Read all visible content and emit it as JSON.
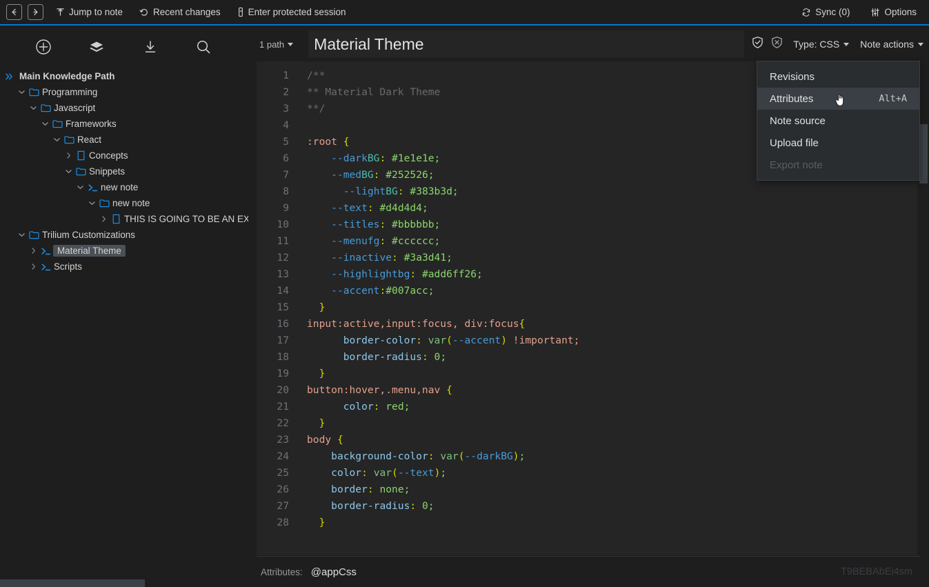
{
  "toolbar": {
    "back_icon": "arrow-left-icon",
    "forward_icon": "arrow-right-icon",
    "jump_to_note": "Jump to note",
    "jump_icon": "map-pin-icon",
    "recent_changes": "Recent changes",
    "recent_icon": "history-icon",
    "protected_session": "Enter protected session",
    "protected_icon": "key-icon",
    "sync": "Sync (0)",
    "sync_icon": "refresh-icon",
    "options": "Options",
    "options_icon": "sliders-icon",
    "accent_color": "#007acc"
  },
  "sidebar": {
    "tools": [
      {
        "name": "new-note-icon",
        "label": "plus-circle-icon"
      },
      {
        "name": "note-map-icon",
        "label": "layers-icon"
      },
      {
        "name": "collapse-tree-icon",
        "label": "download-icon"
      },
      {
        "name": "search-icon",
        "label": "search-icon"
      }
    ],
    "tree": [
      {
        "label": "Main Knowledge Path",
        "depth": 0,
        "twisty": "root",
        "icon": "root-chevrons-icon",
        "selected": false
      },
      {
        "label": "Programming",
        "depth": 1,
        "twisty": "down",
        "icon": "folder-icon",
        "selected": false
      },
      {
        "label": "Javascript",
        "depth": 2,
        "twisty": "down",
        "icon": "folder-icon",
        "selected": false
      },
      {
        "label": "Frameworks",
        "depth": 3,
        "twisty": "down",
        "icon": "folder-icon",
        "selected": false
      },
      {
        "label": "React",
        "depth": 4,
        "twisty": "down",
        "icon": "folder-icon",
        "selected": false
      },
      {
        "label": "Concepts",
        "depth": 5,
        "twisty": "right",
        "icon": "note-icon",
        "selected": false
      },
      {
        "label": "Snippets",
        "depth": 5,
        "twisty": "down",
        "icon": "folder-icon",
        "selected": false
      },
      {
        "label": "new note",
        "depth": 6,
        "twisty": "down",
        "icon": "code-icon",
        "selected": false
      },
      {
        "label": "new note",
        "depth": 7,
        "twisty": "down",
        "icon": "folder-icon",
        "selected": false
      },
      {
        "label": "THIS IS GOING TO BE AN EXT",
        "depth": 8,
        "twisty": "right",
        "icon": "note-icon",
        "selected": false
      },
      {
        "label": "Trilium Customizations",
        "depth": 1,
        "twisty": "down",
        "icon": "folder-icon",
        "selected": false
      },
      {
        "label": "Material Theme",
        "depth": 2,
        "twisty": "right",
        "icon": "code-icon",
        "selected": true
      },
      {
        "label": "Scripts",
        "depth": 2,
        "twisty": "right",
        "icon": "code-icon",
        "selected": false
      }
    ]
  },
  "note": {
    "path_label": "1 path",
    "title": "Material Theme",
    "protect_on_icon": "shield-check-icon",
    "protect_off_icon": "shield-x-icon",
    "type_label": "Type: CSS",
    "actions_label": "Note actions"
  },
  "menu": {
    "items": [
      {
        "label": "Revisions",
        "shortcut": "",
        "active": false,
        "disabled": false
      },
      {
        "label": "Attributes",
        "shortcut": "Alt+A",
        "active": true,
        "disabled": false
      },
      {
        "label": "Note source",
        "shortcut": "",
        "active": false,
        "disabled": false
      },
      {
        "label": "Upload file",
        "shortcut": "",
        "active": false,
        "disabled": false
      },
      {
        "label": "Export note",
        "shortcut": "",
        "active": false,
        "disabled": true
      }
    ]
  },
  "editor": {
    "language": "css",
    "lines": [
      {
        "n": 1,
        "tokens": [
          {
            "t": "/**",
            "c": "c-com"
          }
        ]
      },
      {
        "n": 2,
        "tokens": [
          {
            "t": "** Material Dark Theme",
            "c": "c-com"
          }
        ]
      },
      {
        "n": 3,
        "tokens": [
          {
            "t": "**/",
            "c": "c-com"
          }
        ]
      },
      {
        "n": 4,
        "tokens": []
      },
      {
        "n": 5,
        "tokens": [
          {
            "t": ":root",
            "c": "c-sel"
          },
          {
            "t": " ",
            "c": ""
          },
          {
            "t": "{",
            "c": "c-brace"
          }
        ]
      },
      {
        "n": 6,
        "tokens": [
          {
            "t": "    ",
            "c": ""
          },
          {
            "t": "--dark",
            "c": "c-var"
          },
          {
            "t": "BG",
            "c": "c-varg"
          },
          {
            "t": ":",
            "c": "c-colon"
          },
          {
            "t": " ",
            "c": ""
          },
          {
            "t": "#1e1e1e;",
            "c": "c-val"
          }
        ]
      },
      {
        "n": 7,
        "tokens": [
          {
            "t": "    ",
            "c": ""
          },
          {
            "t": "--med",
            "c": "c-var"
          },
          {
            "t": "BG",
            "c": "c-varg"
          },
          {
            "t": ":",
            "c": "c-colon"
          },
          {
            "t": " ",
            "c": ""
          },
          {
            "t": "#252526;",
            "c": "c-val"
          }
        ]
      },
      {
        "n": 8,
        "tokens": [
          {
            "t": "      ",
            "c": ""
          },
          {
            "t": "--light",
            "c": "c-var"
          },
          {
            "t": "BG",
            "c": "c-varg"
          },
          {
            "t": ":",
            "c": "c-colon"
          },
          {
            "t": " ",
            "c": ""
          },
          {
            "t": "#383b3d;",
            "c": "c-val"
          }
        ]
      },
      {
        "n": 9,
        "tokens": [
          {
            "t": "    ",
            "c": ""
          },
          {
            "t": "--text",
            "c": "c-var"
          },
          {
            "t": ":",
            "c": "c-colon"
          },
          {
            "t": " ",
            "c": ""
          },
          {
            "t": "#d4d4d4;",
            "c": "c-val"
          }
        ]
      },
      {
        "n": 10,
        "tokens": [
          {
            "t": "    ",
            "c": ""
          },
          {
            "t": "--titles",
            "c": "c-var"
          },
          {
            "t": ":",
            "c": "c-colon"
          },
          {
            "t": " ",
            "c": ""
          },
          {
            "t": "#bbbbbb;",
            "c": "c-val"
          }
        ]
      },
      {
        "n": 11,
        "tokens": [
          {
            "t": "    ",
            "c": ""
          },
          {
            "t": "--menufg",
            "c": "c-var"
          },
          {
            "t": ":",
            "c": "c-colon"
          },
          {
            "t": " ",
            "c": ""
          },
          {
            "t": "#cccccc;",
            "c": "c-val"
          }
        ]
      },
      {
        "n": 12,
        "tokens": [
          {
            "t": "    ",
            "c": ""
          },
          {
            "t": "--inactive",
            "c": "c-var"
          },
          {
            "t": ":",
            "c": "c-colon"
          },
          {
            "t": " ",
            "c": ""
          },
          {
            "t": "#3a3d41;",
            "c": "c-val"
          }
        ]
      },
      {
        "n": 13,
        "tokens": [
          {
            "t": "    ",
            "c": ""
          },
          {
            "t": "--highlightbg",
            "c": "c-var"
          },
          {
            "t": ":",
            "c": "c-colon"
          },
          {
            "t": " ",
            "c": ""
          },
          {
            "t": "#add6ff26;",
            "c": "c-val"
          }
        ]
      },
      {
        "n": 14,
        "tokens": [
          {
            "t": "    ",
            "c": ""
          },
          {
            "t": "--accent",
            "c": "c-var"
          },
          {
            "t": ":",
            "c": "c-colon"
          },
          {
            "t": "#007acc;",
            "c": "c-val"
          }
        ]
      },
      {
        "n": 15,
        "tokens": [
          {
            "t": "  ",
            "c": ""
          },
          {
            "t": "}",
            "c": "c-brace"
          }
        ]
      },
      {
        "n": 16,
        "tokens": [
          {
            "t": "input:active,input:focus, div:focus",
            "c": "c-sel"
          },
          {
            "t": "{",
            "c": "c-brace"
          }
        ]
      },
      {
        "n": 17,
        "tokens": [
          {
            "t": "      ",
            "c": ""
          },
          {
            "t": "border-color",
            "c": "c-prop"
          },
          {
            "t": ":",
            "c": "c-colon"
          },
          {
            "t": " ",
            "c": ""
          },
          {
            "t": "var",
            "c": "c-fn"
          },
          {
            "t": "(",
            "c": "c-paren"
          },
          {
            "t": "--accent",
            "c": "c-var"
          },
          {
            "t": ")",
            "c": "c-paren"
          },
          {
            "t": " ",
            "c": ""
          },
          {
            "t": "!important;",
            "c": "c-imp"
          }
        ]
      },
      {
        "n": 18,
        "tokens": [
          {
            "t": "      ",
            "c": ""
          },
          {
            "t": "border-radius",
            "c": "c-prop"
          },
          {
            "t": ":",
            "c": "c-colon"
          },
          {
            "t": " ",
            "c": ""
          },
          {
            "t": "0;",
            "c": "c-val"
          }
        ]
      },
      {
        "n": 19,
        "tokens": [
          {
            "t": "  ",
            "c": ""
          },
          {
            "t": "}",
            "c": "c-brace"
          }
        ]
      },
      {
        "n": 20,
        "tokens": [
          {
            "t": "button:hover,.menu,nav",
            "c": "c-sel"
          },
          {
            "t": " ",
            "c": ""
          },
          {
            "t": "{",
            "c": "c-brace"
          }
        ]
      },
      {
        "n": 21,
        "tokens": [
          {
            "t": "      ",
            "c": ""
          },
          {
            "t": "color",
            "c": "c-prop"
          },
          {
            "t": ":",
            "c": "c-colon"
          },
          {
            "t": " ",
            "c": ""
          },
          {
            "t": "red;",
            "c": "c-val"
          }
        ]
      },
      {
        "n": 22,
        "tokens": [
          {
            "t": "  ",
            "c": ""
          },
          {
            "t": "}",
            "c": "c-brace"
          }
        ]
      },
      {
        "n": 23,
        "tokens": [
          {
            "t": "body",
            "c": "c-sel"
          },
          {
            "t": " ",
            "c": ""
          },
          {
            "t": "{",
            "c": "c-brace"
          }
        ]
      },
      {
        "n": 24,
        "tokens": [
          {
            "t": "    ",
            "c": ""
          },
          {
            "t": "background-color",
            "c": "c-prop"
          },
          {
            "t": ":",
            "c": "c-colon"
          },
          {
            "t": " ",
            "c": ""
          },
          {
            "t": "var",
            "c": "c-fn"
          },
          {
            "t": "(",
            "c": "c-paren"
          },
          {
            "t": "--darkBG",
            "c": "c-var"
          },
          {
            "t": ")",
            "c": "c-paren"
          },
          {
            "t": ";",
            "c": "c-val"
          }
        ]
      },
      {
        "n": 25,
        "tokens": [
          {
            "t": "    ",
            "c": ""
          },
          {
            "t": "color",
            "c": "c-prop"
          },
          {
            "t": ":",
            "c": "c-colon"
          },
          {
            "t": " ",
            "c": ""
          },
          {
            "t": "var",
            "c": "c-fn"
          },
          {
            "t": "(",
            "c": "c-paren"
          },
          {
            "t": "--text",
            "c": "c-var"
          },
          {
            "t": ")",
            "c": "c-paren"
          },
          {
            "t": ";",
            "c": "c-val"
          }
        ]
      },
      {
        "n": 26,
        "tokens": [
          {
            "t": "    ",
            "c": ""
          },
          {
            "t": "border",
            "c": "c-prop"
          },
          {
            "t": ":",
            "c": "c-colon"
          },
          {
            "t": " ",
            "c": ""
          },
          {
            "t": "none;",
            "c": "c-val"
          }
        ]
      },
      {
        "n": 27,
        "tokens": [
          {
            "t": "    ",
            "c": ""
          },
          {
            "t": "border-radius",
            "c": "c-prop"
          },
          {
            "t": ":",
            "c": "c-colon"
          },
          {
            "t": " ",
            "c": ""
          },
          {
            "t": "0;",
            "c": "c-val"
          }
        ]
      },
      {
        "n": 28,
        "tokens": [
          {
            "t": "  ",
            "c": ""
          },
          {
            "t": "}",
            "c": "c-brace"
          }
        ]
      }
    ]
  },
  "attributes": {
    "label": "Attributes:",
    "value": "@appCss",
    "note_id": "T9BEBAbEi4sm"
  }
}
